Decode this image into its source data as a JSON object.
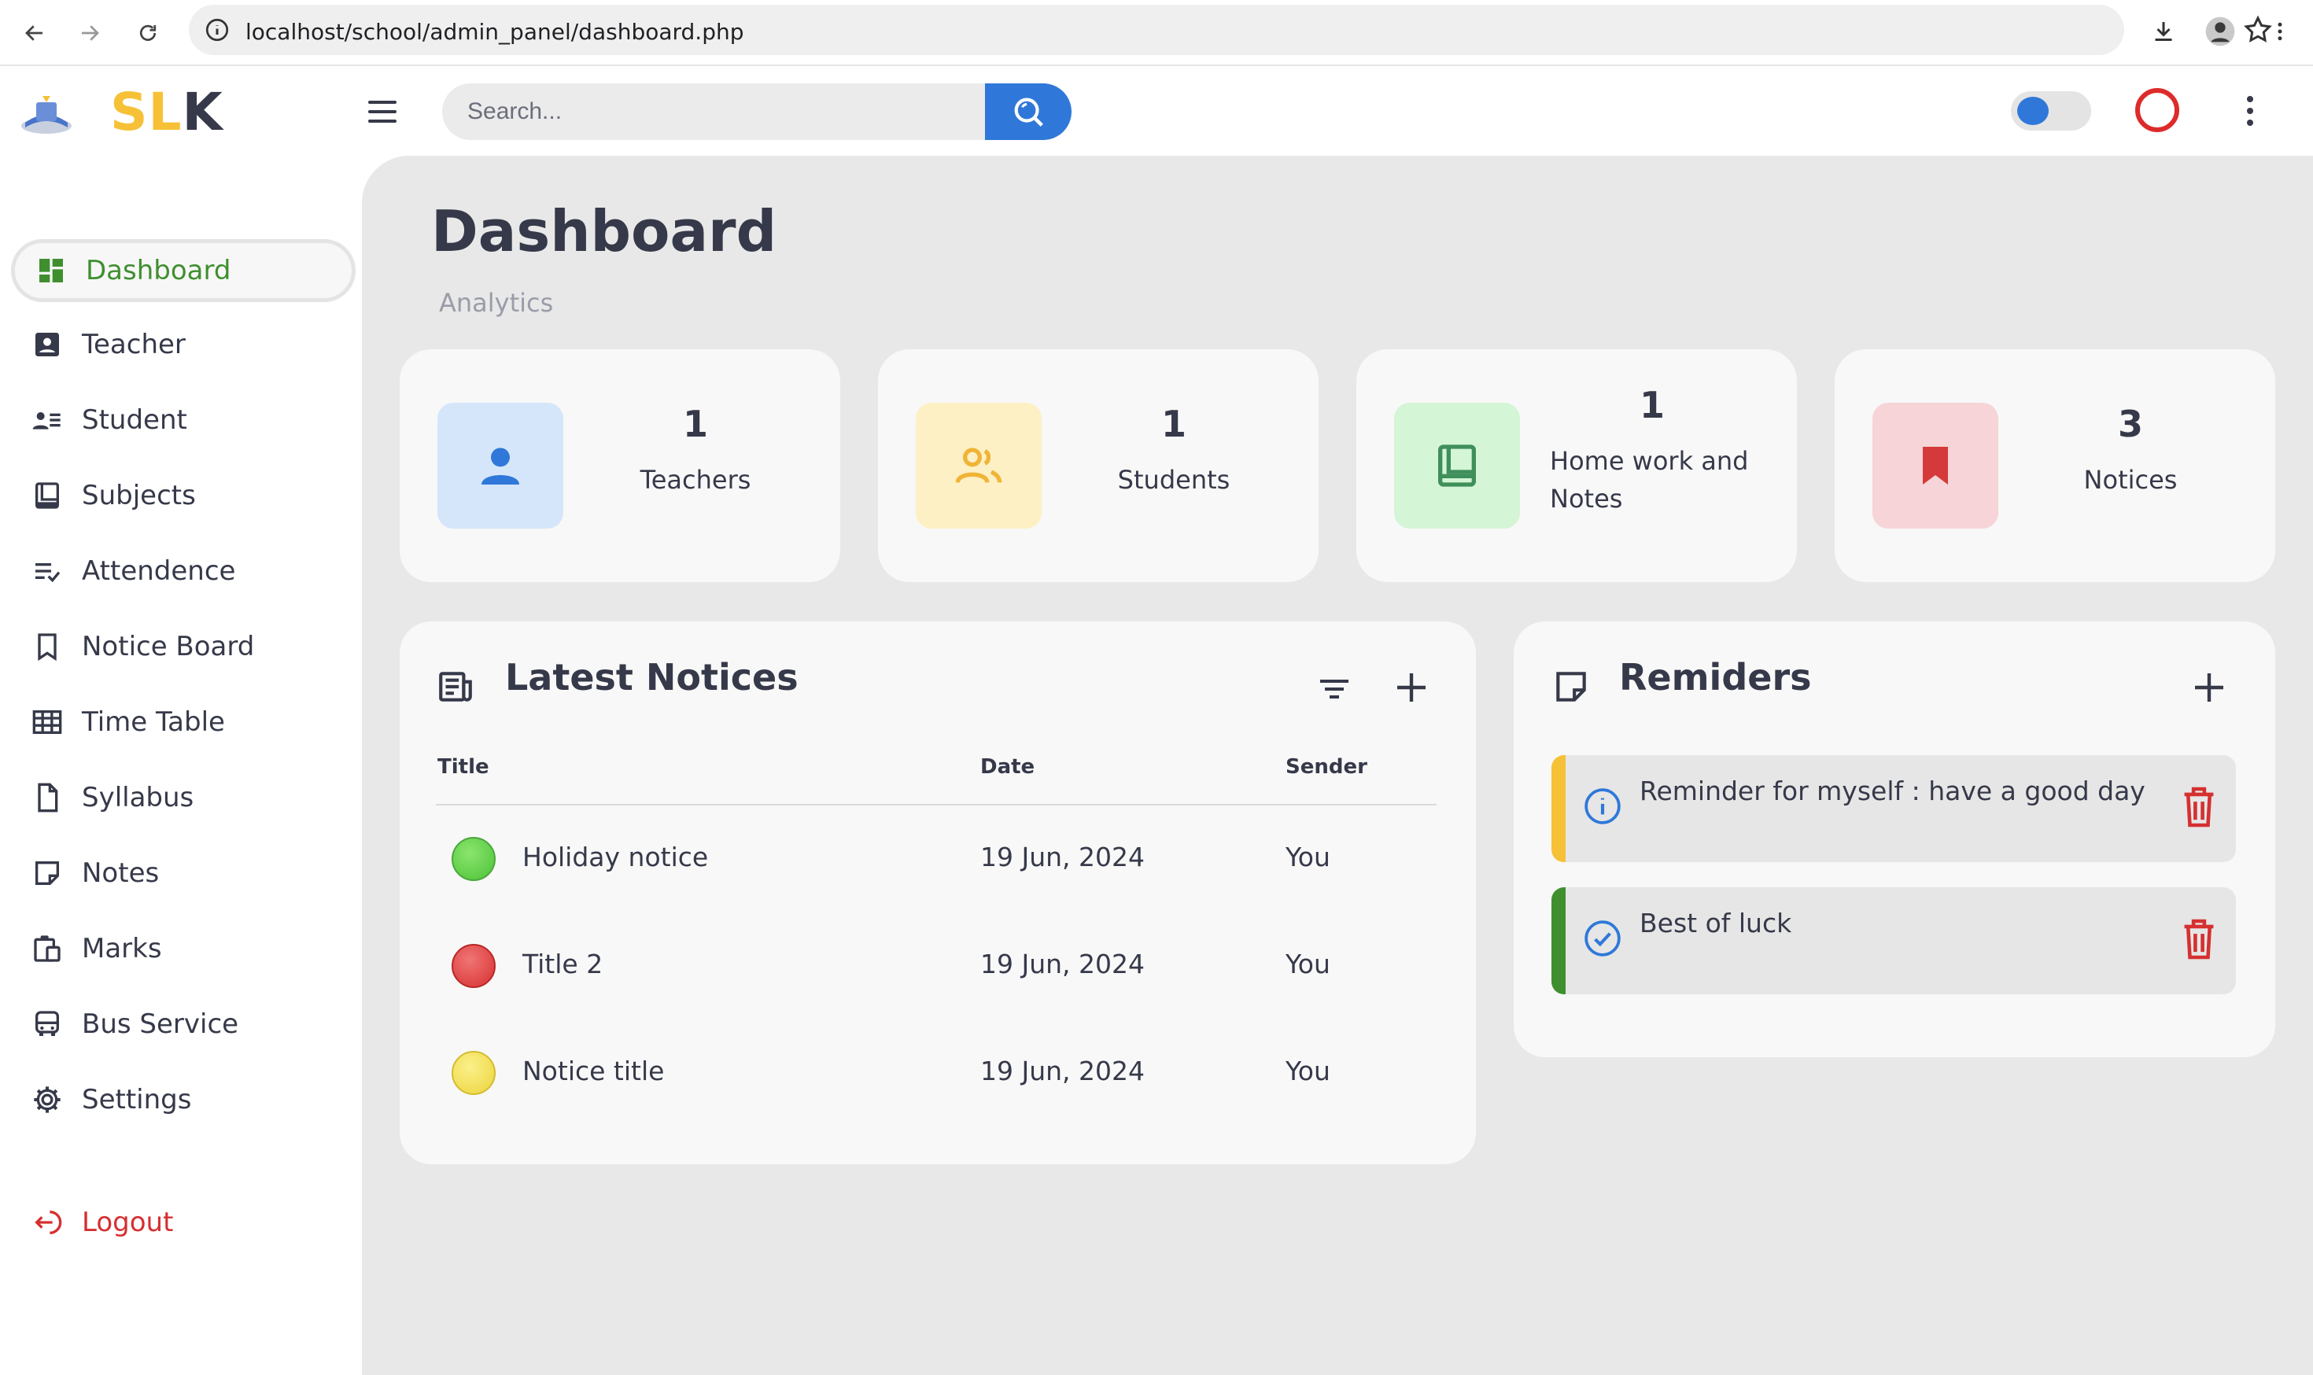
{
  "browser": {
    "url": "localhost/school/admin_panel/dashboard.php"
  },
  "header": {
    "logo_part1": "SL",
    "logo_part2": "K",
    "search_placeholder": "Search..."
  },
  "sidebar": {
    "items": [
      {
        "label": "Dashboard",
        "icon": "dashboard-icon"
      },
      {
        "label": "Teacher",
        "icon": "teacher-icon"
      },
      {
        "label": "Student",
        "icon": "student-icon"
      },
      {
        "label": "Subjects",
        "icon": "book-icon"
      },
      {
        "label": "Attendence",
        "icon": "checklist-icon"
      },
      {
        "label": "Notice Board",
        "icon": "bookmark-icon"
      },
      {
        "label": "Time Table",
        "icon": "grid-icon"
      },
      {
        "label": "Syllabus",
        "icon": "document-icon"
      },
      {
        "label": "Notes",
        "icon": "note-icon"
      },
      {
        "label": "Marks",
        "icon": "clipboard-icon"
      },
      {
        "label": "Bus Service",
        "icon": "bus-icon"
      },
      {
        "label": "Settings",
        "icon": "gear-icon"
      }
    ],
    "logout": "Logout"
  },
  "page": {
    "title": "Dashboard",
    "subtitle": "Analytics"
  },
  "stats": [
    {
      "value": "1",
      "label": "Teachers",
      "bg": "#d5e6fb",
      "color": "#2f78d9"
    },
    {
      "value": "1",
      "label": "Students",
      "bg": "#fdf0c4",
      "color": "#f0b437"
    },
    {
      "value": "1",
      "label": "Home work and Notes",
      "bg": "#d4f5d6",
      "color": "#3f8f5a"
    },
    {
      "value": "3",
      "label": "Notices",
      "bg": "#f6d4d7",
      "color": "#d53a3a"
    }
  ],
  "notices": {
    "title": "Latest Notices",
    "columns": {
      "title": "Title",
      "date": "Date",
      "sender": "Sender"
    },
    "rows": [
      {
        "title": "Holiday notice",
        "date": "19 Jun, 2024",
        "sender": "You",
        "color": "#5bcf3f"
      },
      {
        "title": "Title 2",
        "date": "19 Jun, 2024",
        "sender": "You",
        "color": "#e03a3a"
      },
      {
        "title": "Notice title",
        "date": "19 Jun, 2024",
        "sender": "You",
        "color": "#f0dc4a"
      }
    ]
  },
  "reminders": {
    "title": "Remiders",
    "items": [
      {
        "text": "Reminder for myself : have a good day",
        "color": "#f6c136",
        "icon": "info-icon"
      },
      {
        "text": "Best of luck",
        "color": "#3f8f2f",
        "icon": "check-circle-icon"
      }
    ]
  },
  "colors": {
    "accent": "#2f78d9",
    "active": "#3f8f2f",
    "danger": "#d53030"
  }
}
